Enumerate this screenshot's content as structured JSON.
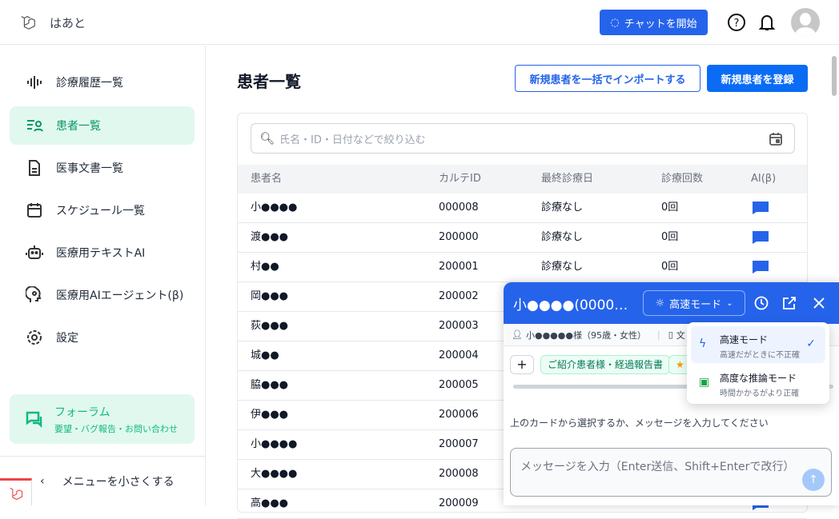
{
  "header": {
    "brand": "はあと",
    "chat_button": "チャットを開始"
  },
  "sidebar": {
    "items": [
      {
        "label": "診療履歴一覧",
        "icon": "waveform-icon"
      },
      {
        "label": "患者一覧",
        "icon": "patients-icon",
        "active": true
      },
      {
        "label": "医事文書一覧",
        "icon": "document-icon"
      },
      {
        "label": "スケジュール一覧",
        "icon": "calendar-icon"
      },
      {
        "label": "医療用テキストAI",
        "icon": "robot-icon"
      },
      {
        "label": "医療用AIエージェント(β)",
        "icon": "head-gear-icon"
      },
      {
        "label": "設定",
        "icon": "gear-icon"
      }
    ],
    "forum": {
      "title": "フォーラム",
      "subtitle": "要望・バグ報告・お問い合わせ"
    },
    "collapse": "メニューを小さくする"
  },
  "main": {
    "title": "患者一覧",
    "import_button": "新規患者を一括でインポートする",
    "register_button": "新規患者を登録",
    "search_placeholder": "氏名・ID・日付などで絞り込む",
    "columns": [
      "患者名",
      "カルテID",
      "最終診療日",
      "診療回数",
      "AI(β)"
    ],
    "rows": [
      [
        "小●●●●",
        "000008",
        "診療なし",
        "0回"
      ],
      [
        "渡●●●",
        "200000",
        "診療なし",
        "0回"
      ],
      [
        "村●●",
        "200001",
        "診療なし",
        "0回"
      ],
      [
        "岡●●●",
        "200002",
        "",
        ""
      ],
      [
        "荻●●●",
        "200003",
        "",
        ""
      ],
      [
        "城●●",
        "200004",
        "",
        ""
      ],
      [
        "脇●●●",
        "200005",
        "",
        ""
      ],
      [
        "伊●●●",
        "200006",
        "",
        ""
      ],
      [
        "小●●●●",
        "200007",
        "",
        ""
      ],
      [
        "大●●●●",
        "200008",
        "",
        ""
      ],
      [
        "高●●●",
        "200009",
        "",
        ""
      ]
    ]
  },
  "chat": {
    "title": "小●●●●(0000…",
    "mode": "高速モード",
    "patient_info": "小●●●●●様（95歳・女性）",
    "doc_label": "文",
    "chips": [
      "ご紹介患者様・経過報告書",
      "★ ..."
    ],
    "hint": "上のカードから選択するか、メッセージを入力してください",
    "input_placeholder": "メッセージを入力（Enter送信、Shift+Enterで改行）",
    "mode_options": [
      {
        "title": "高速モード",
        "desc": "高速だがときに不正確",
        "selected": true
      },
      {
        "title": "高度な推論モード",
        "desc": "時間かかるがより正確"
      }
    ]
  },
  "colors": {
    "primary": "#2563eb",
    "accent": "#10b981"
  }
}
